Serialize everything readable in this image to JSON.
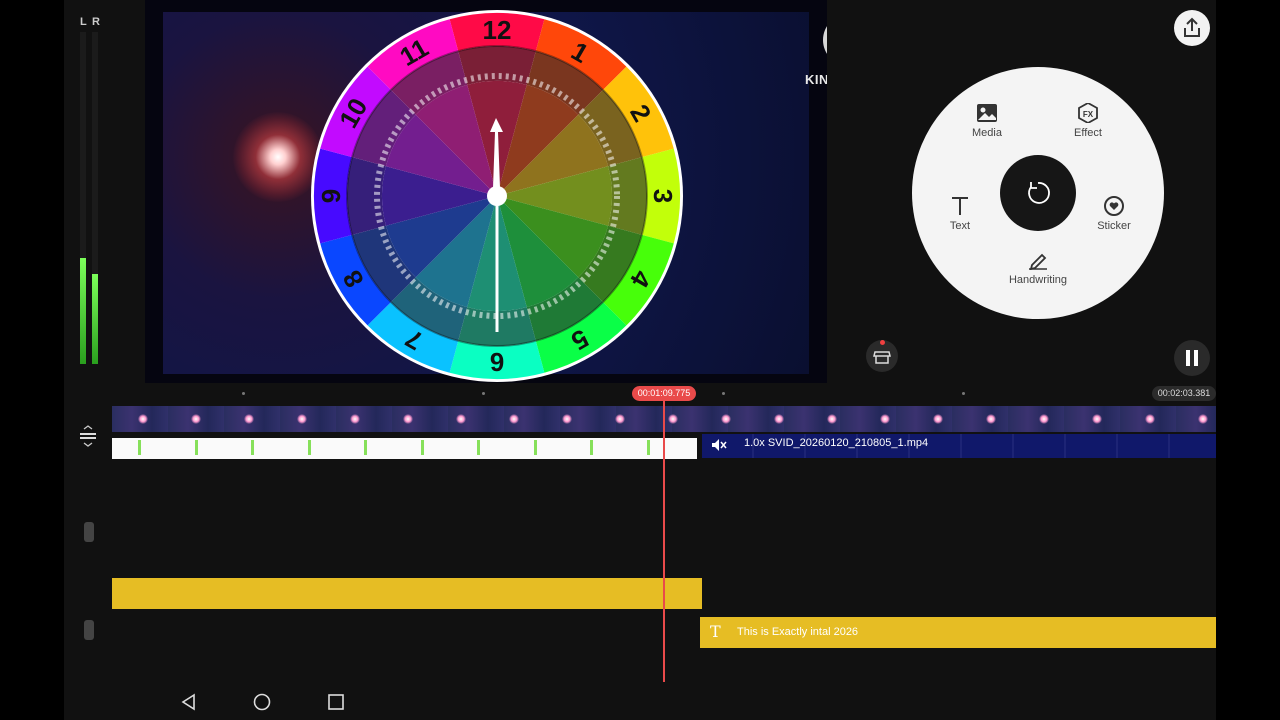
{
  "meter": {
    "left_label": "L",
    "right_label": "R",
    "left_level": 0.32,
    "right_level": 0.27
  },
  "preview": {
    "logo_letter": "K",
    "logo_text": "KINEMASTER",
    "clock_numbers": [
      "12",
      "1",
      "2",
      "3",
      "4",
      "5",
      "6",
      "7",
      "8",
      "9",
      "10",
      "11"
    ]
  },
  "dial": {
    "media_label": "Media",
    "effect_label": "Effect",
    "text_label": "Text",
    "sticker_label": "Sticker",
    "handwriting_label": "Handwriting"
  },
  "timeline": {
    "current_time": "00:01:09.775",
    "end_time": "00:02:03.381",
    "video_clip_name": "1.0x SVID_20260120_210805_1.mp4",
    "text_clip_label": "This is Exactly intal 2026"
  },
  "colors": {
    "accent_red": "#e94a4a",
    "text_layer_yellow": "#e6bd24",
    "meter_green": "#4fd12e",
    "video_clip_blue": "#10186a"
  },
  "icons": {
    "share": "share-icon",
    "store": "store-icon",
    "pause": "pause-icon",
    "undo": "rotate-icon",
    "mute": "mute-icon"
  }
}
